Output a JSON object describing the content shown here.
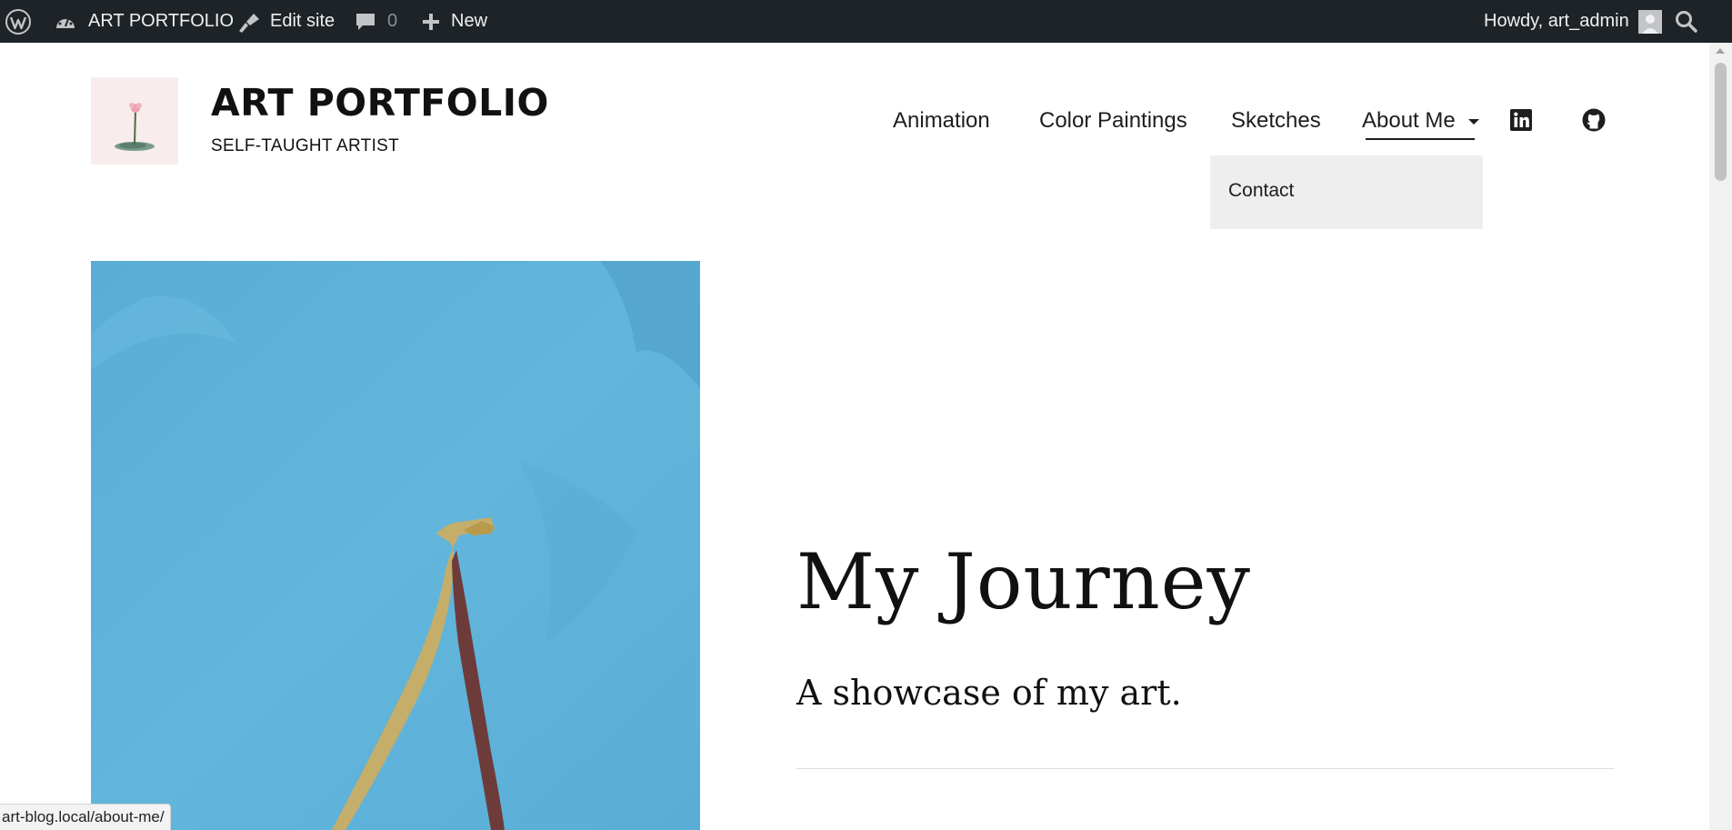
{
  "admin_bar": {
    "site_name": "ART PORTFOLIO",
    "edit_site": "Edit site",
    "comments_count": "0",
    "new_label": "New",
    "howdy": "Howdy, art_admin"
  },
  "header": {
    "title": "ART PORTFOLIO",
    "tagline": "SELF-TAUGHT ARTIST",
    "nav": [
      "Animation",
      "Color Paintings",
      "Sketches",
      "About Me"
    ],
    "submenu": [
      "Contact"
    ],
    "social": [
      "linkedin-icon",
      "github-icon"
    ]
  },
  "hero": {
    "title": "My Journey",
    "subtitle": "A showcase of my art."
  },
  "status_bar": {
    "url": "art-blog.local/about-me/"
  },
  "colors": {
    "admin_bar_bg": "#1d2327",
    "submenu_bg": "#eeeeee",
    "hero_sky": "#5aafd6"
  }
}
